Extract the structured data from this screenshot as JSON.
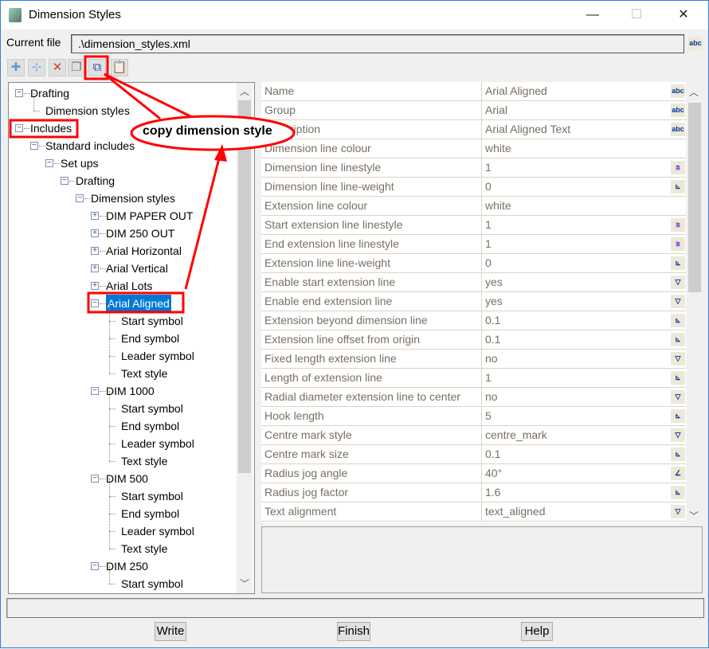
{
  "window": {
    "title": "Dimension Styles",
    "minimize": "—",
    "maximize": "☐",
    "close": "✕"
  },
  "file": {
    "label": "Current file",
    "value": ".\\dimension_styles.xml"
  },
  "toolbar": [
    {
      "name": "add-icon",
      "glyph": "✚",
      "color": "#6a9ad8"
    },
    {
      "name": "add-child-icon",
      "glyph": "⊹",
      "color": "#6a9ad8"
    },
    {
      "name": "delete-icon",
      "glyph": "✕",
      "color": "#d04040"
    },
    {
      "name": "rename-icon",
      "glyph": "❐",
      "color": "#777"
    },
    {
      "name": "copy-icon",
      "glyph": "⧉",
      "color": "#3050b0"
    },
    {
      "name": "paste-icon",
      "glyph": "📋",
      "color": "#a08040"
    }
  ],
  "tree": [
    {
      "label": "Drafting",
      "level": 0,
      "exp": "-"
    },
    {
      "label": "Dimension styles",
      "level": 1,
      "exp": ""
    },
    {
      "label": "Includes",
      "level": 0,
      "exp": "-"
    },
    {
      "label": "Standard includes",
      "level": 1,
      "exp": "-"
    },
    {
      "label": "Set ups",
      "level": 2,
      "exp": "-"
    },
    {
      "label": "Drafting",
      "level": 3,
      "exp": "-"
    },
    {
      "label": "Dimension styles",
      "level": 4,
      "exp": "-"
    },
    {
      "label": "DIM PAPER OUT",
      "level": 5,
      "exp": "+"
    },
    {
      "label": "DIM 250 OUT",
      "level": 5,
      "exp": "+"
    },
    {
      "label": "Arial Horizontal",
      "level": 5,
      "exp": "+"
    },
    {
      "label": "Arial Vertical",
      "level": 5,
      "exp": "+"
    },
    {
      "label": "Arial Lots",
      "level": 5,
      "exp": "+"
    },
    {
      "label": "Arial Aligned",
      "level": 5,
      "exp": "-",
      "selected": true
    },
    {
      "label": "Start symbol",
      "level": 6,
      "exp": ""
    },
    {
      "label": "End symbol",
      "level": 6,
      "exp": ""
    },
    {
      "label": "Leader symbol",
      "level": 6,
      "exp": ""
    },
    {
      "label": "Text style",
      "level": 6,
      "exp": ""
    },
    {
      "label": "DIM 1000",
      "level": 5,
      "exp": "-"
    },
    {
      "label": "Start symbol",
      "level": 6,
      "exp": ""
    },
    {
      "label": "End symbol",
      "level": 6,
      "exp": ""
    },
    {
      "label": "Leader symbol",
      "level": 6,
      "exp": ""
    },
    {
      "label": "Text style",
      "level": 6,
      "exp": ""
    },
    {
      "label": "DIM 500",
      "level": 5,
      "exp": "-"
    },
    {
      "label": "Start symbol",
      "level": 6,
      "exp": ""
    },
    {
      "label": "End symbol",
      "level": 6,
      "exp": ""
    },
    {
      "label": "Leader symbol",
      "level": 6,
      "exp": ""
    },
    {
      "label": "Text style",
      "level": 6,
      "exp": ""
    },
    {
      "label": "DIM 250",
      "level": 5,
      "exp": "-"
    },
    {
      "label": "Start symbol",
      "level": 6,
      "exp": ""
    }
  ],
  "properties": [
    {
      "name": "Name",
      "value": "Arial Aligned",
      "icon": "text"
    },
    {
      "name": "Group",
      "value": "Arial",
      "icon": "text"
    },
    {
      "name": "Description",
      "value": "Arial Aligned Text",
      "icon": "text"
    },
    {
      "name": "Dimension line colour",
      "value": "white",
      "icon": ""
    },
    {
      "name": "Dimension line linestyle",
      "value": "1",
      "icon": "linestyle"
    },
    {
      "name": "Dimension line line-weight",
      "value": "0",
      "icon": "measure"
    },
    {
      "name": "Extension line colour",
      "value": "white",
      "icon": ""
    },
    {
      "name": "Start extension line linestyle",
      "value": "1",
      "icon": "linestyle"
    },
    {
      "name": "End extension line linestyle",
      "value": "1",
      "icon": "linestyle"
    },
    {
      "name": "Extension line line-weight",
      "value": "0",
      "icon": "measure"
    },
    {
      "name": "Enable start extension line",
      "value": "yes",
      "icon": "dropdown"
    },
    {
      "name": "Enable end extension line",
      "value": "yes",
      "icon": "dropdown"
    },
    {
      "name": "Extension beyond dimension line",
      "value": "0.1",
      "icon": "measure"
    },
    {
      "name": "Extension line offset from origin",
      "value": "0.1",
      "icon": "measure"
    },
    {
      "name": "Fixed length extension line",
      "value": "no",
      "icon": "dropdown"
    },
    {
      "name": "Length of extension line",
      "value": "1",
      "icon": "measure"
    },
    {
      "name": "Radial diameter extension line to center",
      "value": "no",
      "icon": "dropdown"
    },
    {
      "name": "Hook length",
      "value": "5",
      "icon": "measure"
    },
    {
      "name": "Centre mark style",
      "value": "centre_mark",
      "icon": "dropdown"
    },
    {
      "name": "Centre mark size",
      "value": "0.1",
      "icon": "measure"
    },
    {
      "name": "Radius jog angle",
      "value": "40°",
      "icon": "angle"
    },
    {
      "name": "Radius jog factor",
      "value": "1.6",
      "icon": "measure"
    },
    {
      "name": "Text alignment",
      "value": "text_aligned",
      "icon": "dropdown"
    }
  ],
  "annotation": {
    "callout": "copy dimension style",
    "color": "#ff0000"
  },
  "buttons": {
    "write": "Write",
    "finish": "Finish",
    "help": "Help"
  }
}
